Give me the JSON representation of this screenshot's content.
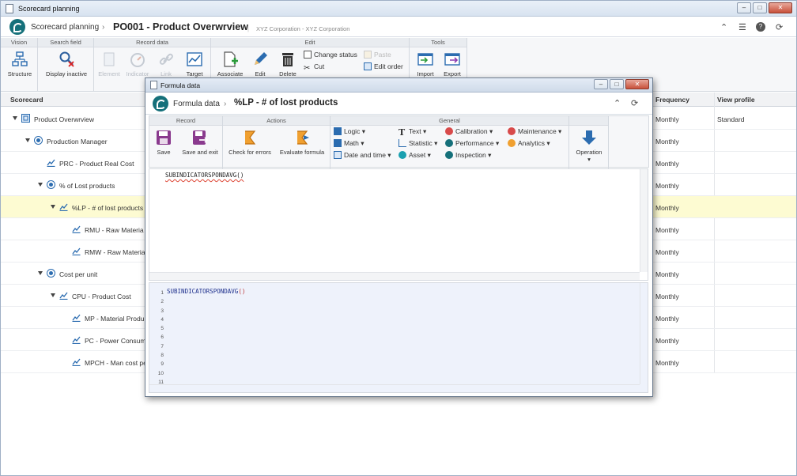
{
  "window": {
    "title": "Scorecard planning"
  },
  "header": {
    "app": "Scorecard planning",
    "title": "PO001 - Product Overwrview",
    "subtitle": "XYZ Corporation - XYZ Corporation"
  },
  "ribbon": {
    "groups": {
      "vision": "Vision",
      "search": "Search field",
      "record": "Record data",
      "edit": "Edit",
      "tools": "Tools"
    },
    "buttons": {
      "structure": "Structure",
      "display_inactive": "Display inactive",
      "element": "Element",
      "indicator": "Indicator",
      "link": "Link",
      "target": "Target",
      "associate": "Associate",
      "edit": "Edit",
      "delete": "Delete",
      "change_status": "Change status",
      "cut": "Cut",
      "paste": "Paste",
      "edit_order": "Edit order",
      "import": "Import",
      "export": "Export"
    }
  },
  "grid": {
    "columns": {
      "scorecard": "Scorecard",
      "frequency": "Frequency",
      "view_profile": "View profile"
    },
    "rows": [
      {
        "label": "Product Overwrview",
        "frequency": "Monthly",
        "profile": "Standard"
      },
      {
        "label": "Production Manager",
        "frequency": "Monthly",
        "profile": ""
      },
      {
        "label": "PRC - Product Real Cost",
        "frequency": "Monthly",
        "profile": ""
      },
      {
        "label": "% of Lost products",
        "frequency": "Monthly",
        "profile": ""
      },
      {
        "label": "%LP - # of lost products",
        "frequency": "Monthly",
        "profile": ""
      },
      {
        "label": "RMU - Raw Materia",
        "frequency": "Monthly",
        "profile": ""
      },
      {
        "label": "RMW - Raw Materia",
        "frequency": "Monthly",
        "profile": ""
      },
      {
        "label": "Cost per unit",
        "frequency": "Monthly",
        "profile": ""
      },
      {
        "label": "CPU - Product Cost",
        "frequency": "Monthly",
        "profile": ""
      },
      {
        "label": "MP - Material Produ",
        "frequency": "Monthly",
        "profile": ""
      },
      {
        "label": "PC - Power Consum",
        "frequency": "Monthly",
        "profile": ""
      },
      {
        "label": "MPCH - Man cost pe",
        "frequency": "Monthly",
        "profile": ""
      }
    ]
  },
  "dialog": {
    "title": "Formula data",
    "breadcrumb": "Formula data",
    "heading": "%LP - # of lost products",
    "groups": {
      "record": "Record",
      "actions": "Actions",
      "general": "General"
    },
    "buttons": {
      "save": "Save",
      "save_exit": "Save and exit",
      "check_errors": "Check for errors",
      "evaluate": "Evaluate formula",
      "operation": "Operation"
    },
    "menus": {
      "logic": "Logic",
      "math": "Math",
      "date_time": "Date and time",
      "text": "Text",
      "statistic": "Statistic",
      "asset": "Asset",
      "calibration": "Calibration",
      "performance": "Performance",
      "inspection": "Inspection",
      "maintenance": "Maintenance",
      "analytics": "Analytics"
    },
    "formula": "SUBINDICATORSPONDAVG()",
    "preview_fn": "SUBINDICATORSPONDAVG",
    "preview_paren": "()",
    "line_numbers": [
      "1",
      "2",
      "3",
      "4",
      "5",
      "6",
      "7",
      "8",
      "9",
      "10",
      "11"
    ]
  }
}
